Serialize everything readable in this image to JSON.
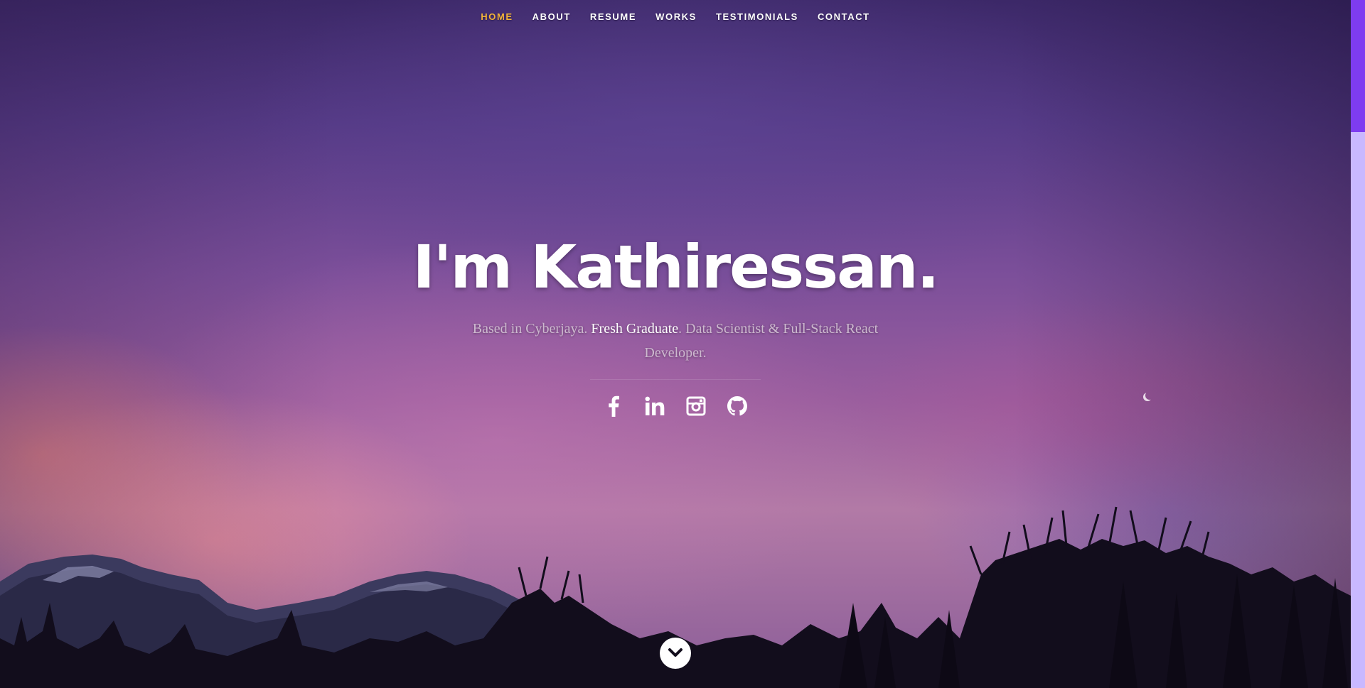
{
  "nav": {
    "items": [
      {
        "label": "HOME",
        "active": true
      },
      {
        "label": "ABOUT",
        "active": false
      },
      {
        "label": "RESUME",
        "active": false
      },
      {
        "label": "WORKS",
        "active": false
      },
      {
        "label": "TESTIMONIALS",
        "active": false
      },
      {
        "label": "CONTACT",
        "active": false
      }
    ],
    "active_color": "#f0b23a",
    "text_color": "#ffffff"
  },
  "hero": {
    "title": "I'm Kathiressan.",
    "subtitle_prefix": "Based in Cyberjaya. ",
    "subtitle_highlight": "Fresh Graduate",
    "subtitle_suffix": ". Data Scientist & Full-Stack React Developer."
  },
  "social": [
    {
      "icon": "facebook-icon"
    },
    {
      "icon": "linkedin-icon"
    },
    {
      "icon": "instagram-icon"
    },
    {
      "icon": "github-icon"
    }
  ],
  "scroll_down": {
    "icon": "chevron-down-icon"
  },
  "colors": {
    "scrollbar_track": "#c9b8ff",
    "scrollbar_thumb": "#7e3cf0"
  }
}
